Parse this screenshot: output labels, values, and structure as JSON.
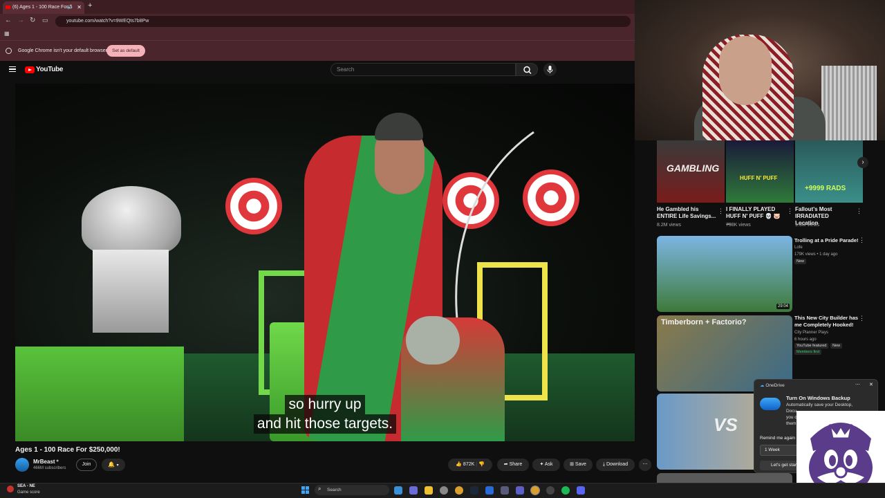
{
  "browser": {
    "tab_title": "(6) Ages 1 - 100 Race For $",
    "url": "youtube.com/watch?v=9WEQts7b8Pw",
    "infobar_text": "Google Chrome isn't your default browser",
    "set_default_label": "Set as default"
  },
  "youtube": {
    "logo_text": "YouTube",
    "search_placeholder": "Search"
  },
  "video": {
    "caption_line1": "so hurry up",
    "caption_line2": "and hit those targets.",
    "title": "Ages 1 - 100 Race For $250,000!",
    "channel": "MrBeast",
    "subscribers": "466M subscribers",
    "join_label": "Join",
    "likes": "872K",
    "share_label": "Share",
    "ask_label": "Ask",
    "save_label": "Save",
    "download_label": "Download"
  },
  "shorts": [
    {
      "overlay": "GAMBLING",
      "title": "He Gambled his ENTIRE Life Savings...",
      "views": "8.2M views",
      "color": "#7a1c1c"
    },
    {
      "overlay": "HUFF N' PUFF",
      "title": "I FINALLY PLAYED HUFF N' PUFF 💀 🐷 ...",
      "views": "798K views",
      "color": "#2f7a3a"
    },
    {
      "overlay": "+9999 RADS",
      "title": "Fallout's Most IRRADIATED Location",
      "views": "9.6M views",
      "color": "#3b8f8a"
    }
  ],
  "recommended": [
    {
      "title": "Trolling at a Pride Parade!",
      "channel": "Lofe",
      "meta": "179K views • 1 day ago",
      "badge": "New",
      "duration": "29:04",
      "thumb_color": "#5fa2d8"
    },
    {
      "title": "This New City Builder has me Completely Hooked!",
      "channel": "City Planner Plays",
      "meta": "6 hours ago",
      "badge": "YouTube featured",
      "badge2": "New",
      "members": "Members first",
      "overlay": "Timberborn + Factorio?",
      "thumb_color": "#7a6a3a"
    },
    {
      "overlay": "VS",
      "thumb_color": "#c9b08a"
    }
  ],
  "toast": {
    "app": "OneDrive",
    "title": "Turn On Windows Backup",
    "line1": "Automatically save your Desktop,",
    "line2": "Docu",
    "line3": "you c",
    "line4": "them",
    "remind_label": "Remind me again",
    "week_option": "1 Week",
    "cta_partial": "Let's get star"
  },
  "taskbar": {
    "weather_title": "SEA - NE",
    "weather_sub": "Game score",
    "search_label": "Search"
  }
}
